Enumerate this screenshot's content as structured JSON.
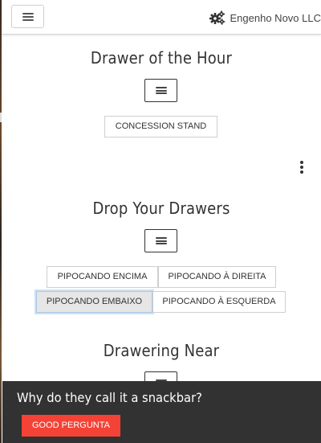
{
  "topbar": {
    "menu_icon": "hamburger-icon",
    "brand_icon": "gears-icon",
    "brand_name": "Engenho Novo LLC"
  },
  "sections": {
    "hour": {
      "title": "Drawer of the Hour",
      "toggle_icon": "hamburger-icon",
      "buttons": [
        "CONCESSION STAND"
      ]
    },
    "drop": {
      "title": "Drop Your Drawers",
      "toggle_icon": "hamburger-icon",
      "buttons": [
        "PIPOCANDO ENCIMA",
        "PIPOCANDO À DIREITA",
        "PIPOCANDO EMBAIXO",
        "PIPOCANDO À ESQUERDA"
      ],
      "selected": "PIPOCANDO EMBAIXO"
    },
    "near": {
      "title": "Drawering Near",
      "toggle_icon": "hamburger-icon"
    }
  },
  "overflow_menu_icon": "more-vert-icon",
  "snackbar": {
    "message": "Why do they call it a snackbar?",
    "action": "GOOD PERGUNTA"
  },
  "colors": {
    "snackbar_bg": "#323232",
    "action_bg": "#f44336",
    "selected_border": "#a8c7e8"
  }
}
